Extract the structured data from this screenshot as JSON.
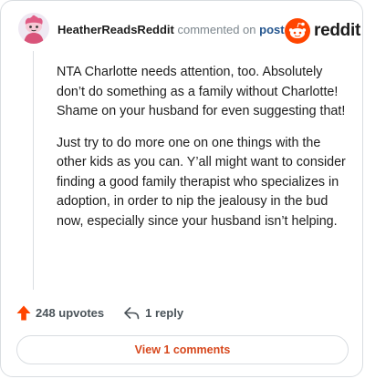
{
  "comment": {
    "username": "HeatherReadsReddit",
    "action_text": "commented on",
    "post_link_text": "post",
    "paragraphs": [
      "NTA Charlotte needs attention, too. Absolutely don’t do something as a family without Charlotte! Shame on your husband for even suggesting that!",
      "Just try to do more one on one things with the other kids as you can. Y’all might want to consider finding a good family therapist who specializes in adoption, in order to nip the jealousy in the bud now, especially since your husband isn’t helping."
    ]
  },
  "brand": {
    "wordmark": "reddit",
    "icon": "reddit-alien-icon",
    "color": "#ff4500"
  },
  "actions": {
    "upvotes_label": "248 upvotes",
    "upvote_icon": "upvote-arrow-icon",
    "reply_label": "1 reply",
    "reply_icon": "reply-arrow-icon"
  },
  "view_comments_label": "View 1 comments",
  "colors": {
    "accent": "#d7481d",
    "upvote": "#ff4500",
    "link": "#24558e"
  }
}
